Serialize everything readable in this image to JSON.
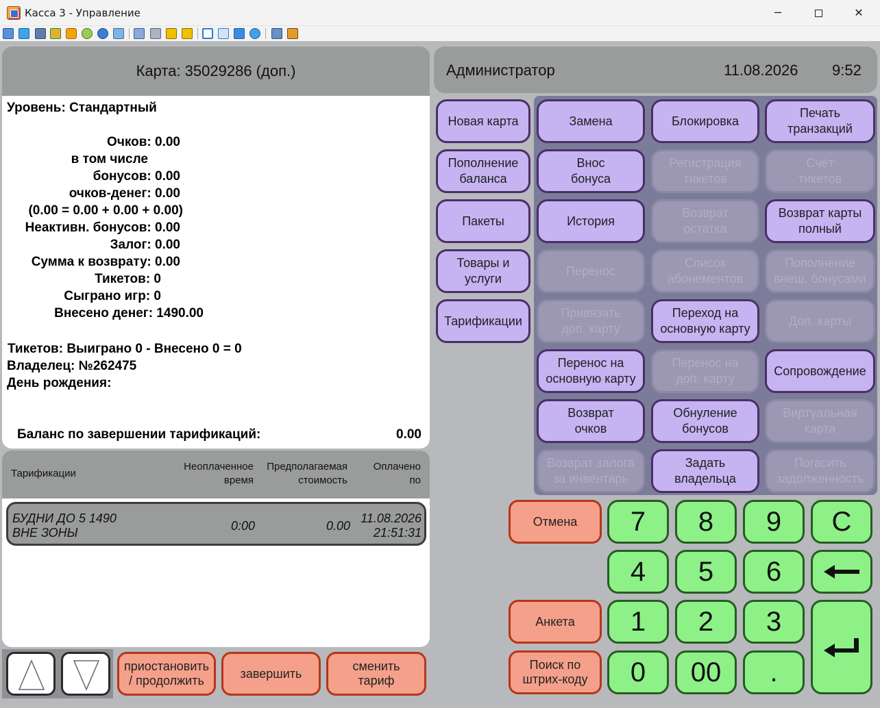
{
  "window": {
    "title": "Касса 3 - Управление",
    "minimize": "─",
    "close": "✕"
  },
  "toolbar_icons": [
    "monitor-icon",
    "display-icon",
    "terminal-icon",
    "arrows-icon",
    "clock-icon",
    "users-icon",
    "phone-icon",
    "message-icon",
    "upload-icon",
    "network-icon",
    "lock-icon",
    "lock-icon",
    "window-icon",
    "fullscreen-icon",
    "square-icon",
    "globe-icon",
    "copy-icon",
    "tools-icon"
  ],
  "card": {
    "header": "Карта: 35029286 (доп.)",
    "level": "Уровень: Стандартный",
    "points": "Очков: 0.00",
    "incl": "в том числе",
    "bonuses": "бонусов: 0.00",
    "money_points": "очков-денег: 0.00",
    "formula": "(0.00 = 0.00 + 0.00 + 0.00)",
    "inactive": "Неактивн. бонусов: 0.00",
    "deposit": "Залог: 0.00",
    "refund": "Сумма к возврату: 0.00",
    "tickets": "Тикетов: 0",
    "games": "Сыграно игр: 0",
    "money": "Внесено денег: 1490.00",
    "tickets_summary": "Тикетов: Выиграно 0 - Внесено 0 = 0",
    "owner": "Владелец: №262475",
    "birthday": "День рождения:",
    "balance_label": "Баланс по завершении тарификаций:",
    "balance_value": "0.00"
  },
  "tariffs": {
    "headers": [
      "Тарификации",
      "Неоплаченное",
      "время",
      "Предполагаемая",
      "стоимость",
      "Оплачено",
      "по"
    ],
    "rows": [
      {
        "name1": "БУДНИ ДО 5 1490",
        "name2": "ВНЕ ЗОНЫ",
        "unpaid": "0:00",
        "cost": "0.00",
        "date": "11.08.2026",
        "time": "21:51:31"
      }
    ]
  },
  "bottom": {
    "pause1": "приостановить",
    "pause2": "/ продолжить",
    "finish": "завершить",
    "change1": "сменить",
    "change2": "тариф"
  },
  "status": {
    "user": "Администратор",
    "date": "11.08.2026",
    "time": "9:52"
  },
  "left_buttons": [
    {
      "l1": "Новая карта",
      "l2": ""
    },
    {
      "l1": "Пополнение",
      "l2": "баланса"
    },
    {
      "l1": "Пакеты",
      "l2": ""
    },
    {
      "l1": "Товары и",
      "l2": "услуги"
    },
    {
      "l1": "Тарификации",
      "l2": ""
    }
  ],
  "grid_buttons": [
    {
      "l1": "Замена",
      "l2": "",
      "enabled": true
    },
    {
      "l1": "Блокировка",
      "l2": "",
      "enabled": true
    },
    {
      "l1": "Печать",
      "l2": "транзакций",
      "enabled": true
    },
    {
      "l1": "Внос",
      "l2": "бонуса",
      "enabled": true
    },
    {
      "l1": "Регистрация",
      "l2": "тикетов",
      "enabled": false
    },
    {
      "l1": "Счёт",
      "l2": "тикетов",
      "enabled": false
    },
    {
      "l1": "История",
      "l2": "",
      "enabled": true
    },
    {
      "l1": "Возврат",
      "l2": "остатка",
      "enabled": false
    },
    {
      "l1": "Возврат карты",
      "l2": "полный",
      "enabled": true
    },
    {
      "l1": "Перенос",
      "l2": "",
      "enabled": false
    },
    {
      "l1": "Список",
      "l2": "абонементов",
      "enabled": false
    },
    {
      "l1": "Пополнение",
      "l2": "внеш. бонусами",
      "enabled": false
    },
    {
      "l1": "Привязать",
      "l2": "доп. карту",
      "enabled": false
    },
    {
      "l1": "Переход на",
      "l2": "основную карту",
      "enabled": true
    },
    {
      "l1": "Доп. карты",
      "l2": "",
      "enabled": false
    },
    {
      "l1": "Перенос на",
      "l2": "основную карту",
      "enabled": true
    },
    {
      "l1": "Перенос на",
      "l2": "доп. карту",
      "enabled": false
    },
    {
      "l1": "Сопровождение",
      "l2": "",
      "enabled": true
    },
    {
      "l1": "Возврат",
      "l2": "очков",
      "enabled": true
    },
    {
      "l1": "Обнуление",
      "l2": "бонусов",
      "enabled": true
    },
    {
      "l1": "Виртуальная",
      "l2": "карта",
      "enabled": false
    },
    {
      "l1": "Возврат залога",
      "l2": "за инвентарь",
      "enabled": false
    },
    {
      "l1": "Задать",
      "l2": "владельца",
      "enabled": true
    },
    {
      "l1": "Погасить",
      "l2": "задолженность",
      "enabled": false
    }
  ],
  "actions": {
    "cancel": "Отмена",
    "form": "Анкета",
    "barcode1": "Поиск по",
    "barcode2": "штрих-коду"
  },
  "keypad": {
    "k7": "7",
    "k8": "8",
    "k9": "9",
    "clear": "C",
    "k4": "4",
    "k5": "5",
    "k6": "6",
    "backspace": "←",
    "k1": "1",
    "k2": "2",
    "k3": "3",
    "k0": "0",
    "k00": "00",
    "dot": ".",
    "enter": "↵"
  }
}
